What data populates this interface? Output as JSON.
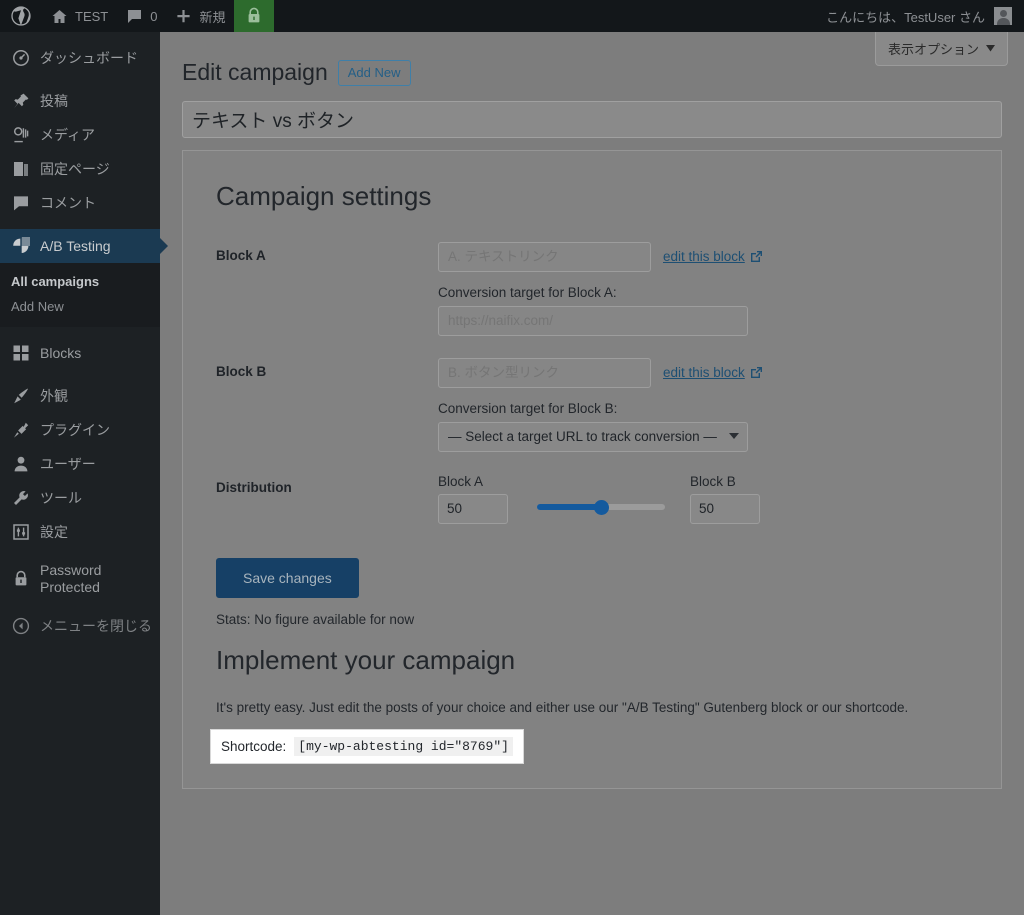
{
  "adminbar": {
    "logo_icon": "wordpress-logo-icon",
    "site_icon": "home-icon",
    "site_name": "TEST",
    "comments_icon": "comment-bubble-icon",
    "comments_count": "0",
    "new_icon": "plus-icon",
    "new_label": "新規",
    "lock_icon": "lock-icon",
    "greeting": "こんにちは、TestUser さん",
    "avatar_icon": "user-avatar"
  },
  "sidebar": {
    "items": [
      {
        "label": "ダッシュボード",
        "icon": "dashboard-icon",
        "current": false
      },
      {
        "label": "投稿",
        "icon": "pin-icon",
        "current": false
      },
      {
        "label": "メディア",
        "icon": "media-icon",
        "current": false
      },
      {
        "label": "固定ページ",
        "icon": "page-icon",
        "current": false
      },
      {
        "label": "コメント",
        "icon": "comment-bubble-icon",
        "current": false
      },
      {
        "label": "A/B Testing",
        "icon": "pie-chart-icon",
        "current": true
      },
      {
        "label": "Blocks",
        "icon": "blocks-grid-icon",
        "current": false
      },
      {
        "label": "外観",
        "icon": "paintbrush-icon",
        "current": false
      },
      {
        "label": "プラグイン",
        "icon": "plug-icon",
        "current": false
      },
      {
        "label": "ユーザー",
        "icon": "user-icon",
        "current": false
      },
      {
        "label": "ツール",
        "icon": "wrench-icon",
        "current": false
      },
      {
        "label": "設定",
        "icon": "sliders-icon",
        "current": false
      },
      {
        "label": "Password Protected",
        "icon": "lock-icon",
        "current": false
      }
    ],
    "submenu": [
      {
        "label": "All campaigns",
        "current": true
      },
      {
        "label": "Add New",
        "current": false
      }
    ],
    "collapse_label": "メニューを閉じる",
    "collapse_icon": "collapse-arrow-icon"
  },
  "screen_options": {
    "label": "表示オプション",
    "icon": "chevron-down-icon"
  },
  "header": {
    "page_title": "Edit campaign",
    "add_new_label": "Add New",
    "campaign_title_value": "テキスト vs ボタン"
  },
  "campaign_settings": {
    "section_title": "Campaign settings",
    "block_a": {
      "label": "Block A",
      "name_placeholder": "A. テキストリンク",
      "edit_link_label": "edit this block",
      "edit_link_icon": "external-link-icon",
      "conversion_label": "Conversion target for Block A:",
      "conversion_placeholder": "https://naifix.com/"
    },
    "block_b": {
      "label": "Block B",
      "name_placeholder": "B. ボタン型リンク",
      "edit_link_label": "edit this block",
      "edit_link_icon": "external-link-icon",
      "conversion_label": "Conversion target for Block B:",
      "select_value": "— Select a target URL to track conversion —",
      "select_icon": "chevron-down-icon"
    },
    "distribution": {
      "label": "Distribution",
      "a_caption": "Block A",
      "a_value": "50",
      "b_caption": "Block B",
      "b_value": "50",
      "slider_percent": 50
    },
    "save_label": "Save changes",
    "stats_text": "Stats: No figure available for now"
  },
  "implement": {
    "section_title": "Implement your campaign",
    "description": "It's pretty easy. Just edit the posts of your choice and either use our \"A/B Testing\" Gutenberg block or our shortcode.",
    "shortcode_label": "Shortcode:",
    "shortcode_value": "[my-wp-abtesting id=\"8769\"]"
  },
  "colors": {
    "adminbar_bg": "#13171a",
    "sidebar_bg": "#1d2124",
    "active_menu_bg": "#1b3a52",
    "lock_badge_green": "#2d6b2d",
    "link_blue": "#1d4f73",
    "save_button_bg": "#164066",
    "slider_blue": "#145a9e"
  }
}
